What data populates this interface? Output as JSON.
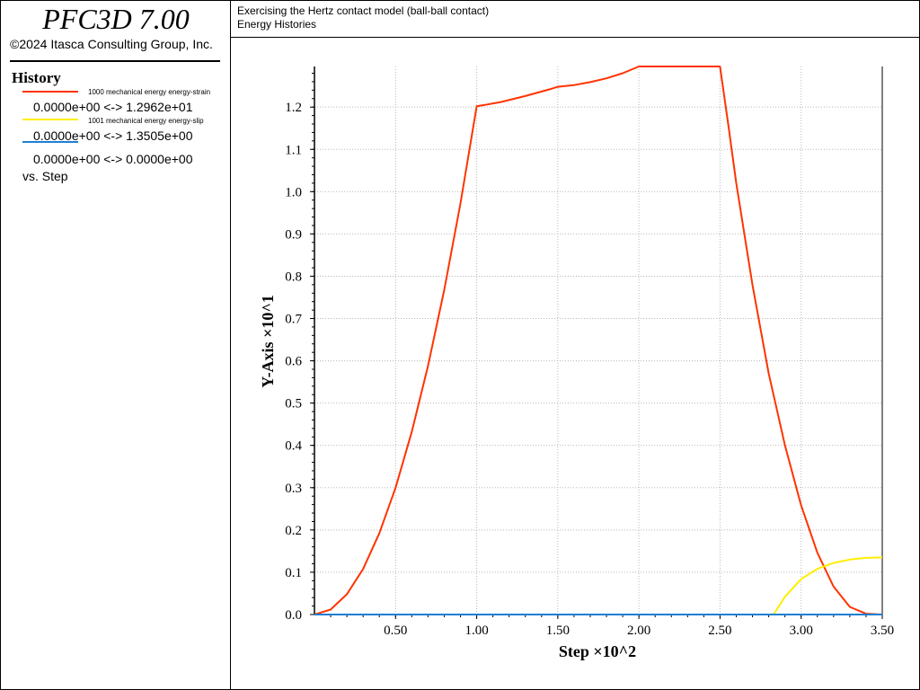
{
  "app": {
    "title": "PFC3D 7.00",
    "copyright": "©2024 Itasca Consulting Group, Inc."
  },
  "header": {
    "line1": "Exercising the Hertz contact model (ball-ball contact)",
    "line2": "Energy Histories"
  },
  "legend": {
    "heading": "History",
    "footer": "vs. Step",
    "items": [
      {
        "name": "1000 mechanical energy energy-strain",
        "range": "0.0000e+00 <->  1.2962e+01",
        "color": "#ff3300"
      },
      {
        "name": "1001 mechanical energy energy-slip",
        "range": "0.0000e+00 <->  1.3505e+00",
        "color": "#ffee00"
      },
      {
        "name": "",
        "range": "0.0000e+00 <->  0.0000e+00",
        "color": "#1e7fd4"
      }
    ]
  },
  "chart_data": {
    "type": "line",
    "xlabel": "Step ×10^2",
    "ylabel": "Y-Axis ×10^1",
    "xlim": [
      0,
      3.5
    ],
    "ylim": [
      0,
      1.296
    ],
    "xticks": [
      "0.50",
      "1.00",
      "1.50",
      "2.00",
      "2.50",
      "3.00",
      "3.50"
    ],
    "yticks": [
      "0.0",
      "0.1",
      "0.2",
      "0.3",
      "0.4",
      "0.5",
      "0.6",
      "0.7",
      "0.8",
      "0.9",
      "1.0",
      "1.1",
      "1.2"
    ],
    "grid": true,
    "series": [
      {
        "name": "1000 mechanical energy energy-strain",
        "color": "#ff3300",
        "x": [
          0,
          0.1,
          0.2,
          0.3,
          0.4,
          0.5,
          0.6,
          0.7,
          0.8,
          0.9,
          1.0,
          1.05,
          1.15,
          1.3,
          1.45,
          1.5,
          1.6,
          1.7,
          1.8,
          1.9,
          2.0,
          2.1,
          2.2,
          2.3,
          2.4,
          2.5,
          2.55,
          2.6,
          2.7,
          2.8,
          2.9,
          3.0,
          3.1,
          3.2,
          3.3,
          3.4,
          3.5
        ],
        "y": [
          0,
          0.012,
          0.048,
          0.108,
          0.192,
          0.3,
          0.432,
          0.588,
          0.768,
          0.972,
          1.202,
          1.205,
          1.212,
          1.226,
          1.242,
          1.248,
          1.252,
          1.259,
          1.268,
          1.28,
          1.296,
          1.296,
          1.296,
          1.296,
          1.296,
          1.296,
          1.16,
          1.02,
          0.78,
          0.57,
          0.4,
          0.258,
          0.146,
          0.066,
          0.018,
          0.002,
          0
        ]
      },
      {
        "name": "1001 mechanical energy energy-slip",
        "color": "#ffee00",
        "x": [
          2.83,
          2.9,
          3.0,
          3.1,
          3.2,
          3.3,
          3.4,
          3.5
        ],
        "y": [
          0,
          0.042,
          0.084,
          0.108,
          0.122,
          0.13,
          0.134,
          0.135
        ]
      },
      {
        "name": "",
        "color": "#1e7fd4",
        "x": [
          0,
          3.5
        ],
        "y": [
          0,
          0
        ]
      }
    ]
  }
}
